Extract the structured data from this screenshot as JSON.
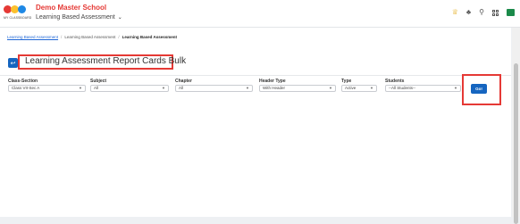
{
  "header": {
    "logo_tagline": "MY CLASSBOARD",
    "school_name": "Demo Master School",
    "module_name": "Learning Based Assessment",
    "icons": [
      "trophy-icon",
      "bell-icon",
      "search-icon",
      "apps-grid-icon",
      "book-icon"
    ]
  },
  "breadcrumb": {
    "items": [
      "Learning Based Assessment",
      "Learning Based Assessment",
      "Learning Based Assessment"
    ]
  },
  "page": {
    "title": "Learning Assessment Report Cards Bulk"
  },
  "filters": {
    "class_section": {
      "label": "Class-Section",
      "value": "Class VII-Sec A"
    },
    "subject": {
      "label": "Subject",
      "value": "All"
    },
    "chapter": {
      "label": "Chapter",
      "value": "All"
    },
    "header_type": {
      "label": "Header Type",
      "value": "With Header"
    },
    "type": {
      "label": "Type",
      "value": "Active"
    },
    "students": {
      "label": "Students",
      "value": "--All Students--"
    }
  },
  "actions": {
    "go_label": "Go!"
  },
  "colors": {
    "primary": "#1565c0",
    "highlight": "#e53935",
    "school": "#e53935"
  }
}
